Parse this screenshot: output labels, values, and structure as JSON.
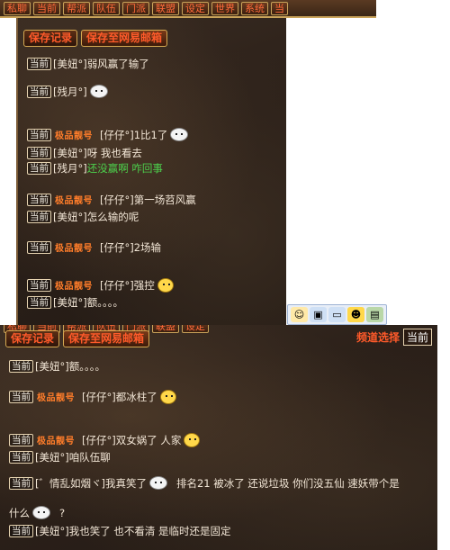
{
  "top_tabs": [
    "私聊",
    "当前",
    "帮派",
    "队伍",
    "门派",
    "联盟",
    "设定",
    "世界",
    "系统",
    "当"
  ],
  "panel1": {
    "save_button": "保存记录",
    "save_mail_button": "保存至网易邮箱",
    "messages": [
      {
        "ch": "当前",
        "vip": false,
        "name": "[美妞°]",
        "text": "弱风赢了输了",
        "emoji": null
      },
      {
        "ch": "当前",
        "vip": false,
        "name": "[残月°]",
        "text": "",
        "emoji": "white"
      },
      {
        "ch": "当前",
        "vip": true,
        "name": "[仔仔°]",
        "text": "1比1了",
        "emoji": "white"
      },
      {
        "ch": "当前",
        "vip": false,
        "name": "[美妞°]",
        "text": "呀  我也看去",
        "emoji": null
      },
      {
        "ch": "当前",
        "vip": false,
        "name": "[残月°]",
        "text": "还没赢啊  咋回事",
        "emoji": null,
        "green": true
      },
      {
        "ch": "当前",
        "vip": true,
        "name": "[仔仔°]",
        "text": "第一场苕风赢",
        "emoji": null
      },
      {
        "ch": "当前",
        "vip": false,
        "name": "[美妞°]",
        "text": "怎么输的呢",
        "emoji": null
      },
      {
        "ch": "当前",
        "vip": true,
        "name": "[仔仔°]",
        "text": "2场输",
        "emoji": null
      },
      {
        "ch": "当前",
        "vip": true,
        "name": "[仔仔°]",
        "text": "强控",
        "emoji": "yellow"
      },
      {
        "ch": "当前",
        "vip": false,
        "name": "[美妞°]",
        "text": "额。。。。",
        "emoji": null
      }
    ],
    "vip_label": "极品靓号"
  },
  "toolbar_icons": [
    "smiley-icon",
    "save-icon",
    "screen-icon",
    "face-icon",
    "picture-icon"
  ],
  "bottom_tabs": [
    "私聊",
    "当前",
    "帮派",
    "队伍",
    "门派",
    "联盟",
    "设定"
  ],
  "panel2": {
    "save_button": "保存记录",
    "save_mail_button": "保存至网易邮箱",
    "channel_select_label": "频道选择",
    "channel_current": "当前",
    "messages": [
      {
        "ch": "当前",
        "vip": false,
        "name": "[美妞°]",
        "text": "额。。。。",
        "emoji": null
      },
      {
        "ch": "当前",
        "vip": true,
        "name": "[仔仔°]",
        "text": "都冰柱了",
        "emoji": "yellow"
      },
      {
        "ch": "当前",
        "vip": true,
        "name": "[仔仔°]",
        "text": "双女娲了  人家",
        "emoji": "yellow"
      },
      {
        "ch": "当前",
        "vip": false,
        "name": "[美妞°]",
        "text": "咱队伍聊",
        "emoji": null
      },
      {
        "ch": "当前",
        "vip": false,
        "name": "[゛情乱如烟ヾ]",
        "text": "我真笑了",
        "emoji": "white",
        "tail": "排名21  被冰了  还说垃圾  你们没五仙  速妖带个是"
      },
      {
        "ch": "",
        "vip": false,
        "name": "",
        "text": "什么",
        "emoji": "white",
        "tail": "?"
      },
      {
        "ch": "当前",
        "vip": false,
        "name": "[美妞°]",
        "text": "我也笑了    也不看清  是临时还是固定",
        "emoji": null
      }
    ],
    "vip_label": "极品靓号"
  },
  "colors": {
    "accent": "#ff5a2a",
    "vip": "#ff7d2a",
    "green_text": "#4cd04c",
    "gold_border": "#d7aa52"
  }
}
